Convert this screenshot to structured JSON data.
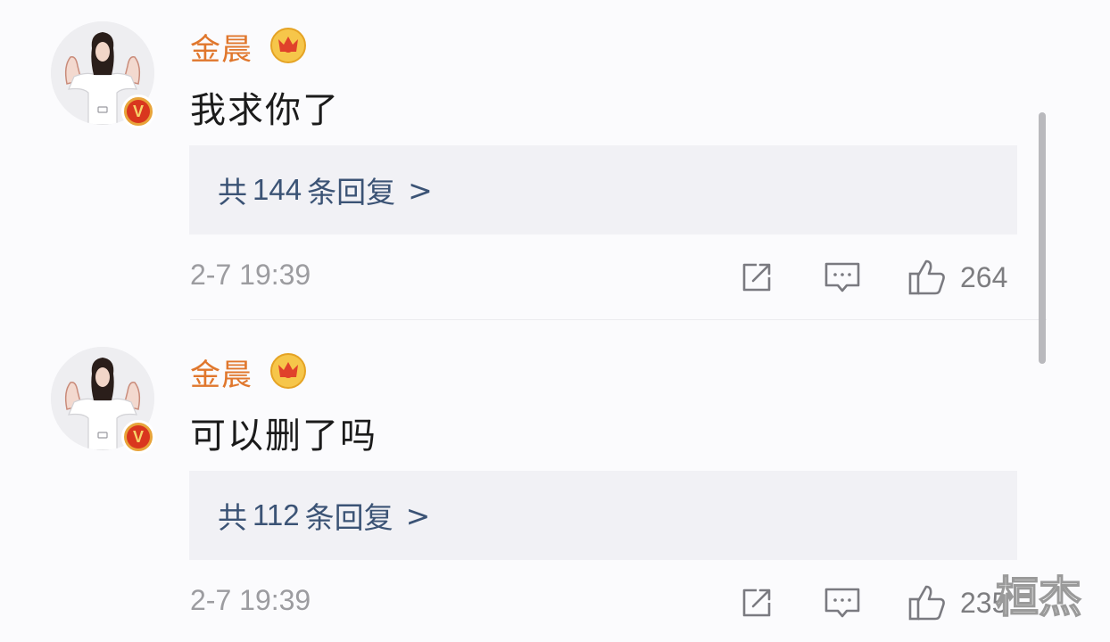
{
  "comments": [
    {
      "username": "金晨",
      "text": "我求你了",
      "replies_prefix": "共",
      "replies_count": "144",
      "replies_suffix": "条回复",
      "replies_arrow": ">",
      "time": "2-7 19:39",
      "likes": "264"
    },
    {
      "username": "金晨",
      "text": "可以删了吗",
      "replies_prefix": "共",
      "replies_count": "112",
      "replies_suffix": "条回复",
      "replies_arrow": ">",
      "time": "2-7 19:39",
      "likes": "235"
    }
  ],
  "icons": {
    "verified": "verified-v-badge-icon",
    "vip": "crown-vip-icon",
    "share": "share-icon",
    "reply": "comment-icon",
    "like": "thumbs-up-icon"
  },
  "colors": {
    "username": "#e0772d",
    "reply_link": "#3b5375",
    "meta": "#9c9ca0",
    "reply_box": "#f1f1f5",
    "verified_badge": "#d9361e"
  },
  "watermark": "桓杰",
  "verified_letter": "V"
}
